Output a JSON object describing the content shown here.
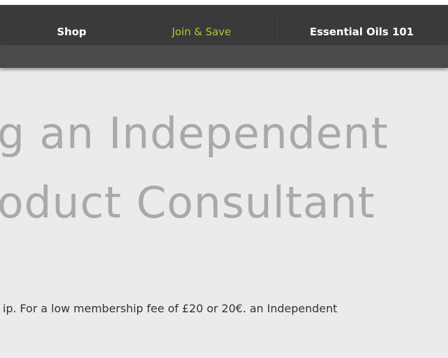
{
  "nav": {
    "items": [
      {
        "label": "Shop"
      },
      {
        "label": "Join & Save"
      },
      {
        "label": "Essential Oils 101"
      }
    ],
    "active_color": "#b5c43a"
  },
  "main": {
    "headline_line1": "g an Independent",
    "headline_line2": "oduct Consultant",
    "body_text": "ip. For a low membership fee of £20 or 20€. an Independent"
  }
}
